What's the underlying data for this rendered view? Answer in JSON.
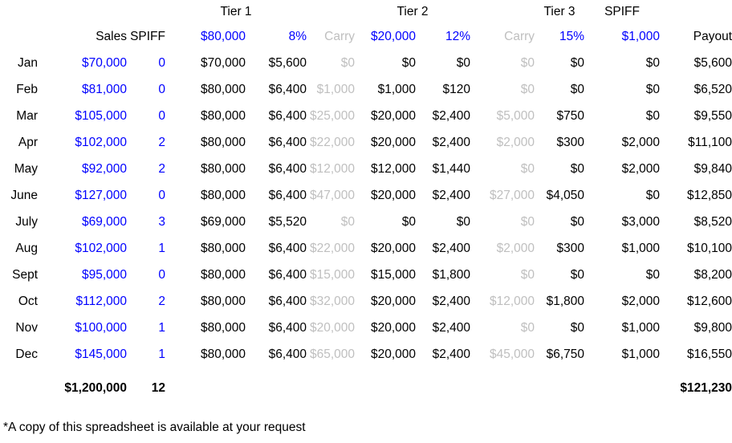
{
  "document": {
    "clipped_caption": "",
    "footnote": "*A copy of this spreadsheet is available at your request"
  },
  "group_headers": {
    "tier1": "Tier 1",
    "tier2": "Tier 2",
    "tier3": "Tier 3",
    "spiff": "SPIFF"
  },
  "columns": {
    "month": "",
    "sales": "Sales",
    "spiff_count": "SPIFF",
    "tier1_threshold": "$80,000",
    "tier1_rate": "8%",
    "carry1": "Carry",
    "tier2_threshold": "$20,000",
    "tier2_rate": "12%",
    "carry2": "Carry",
    "tier3_rate": "15%",
    "spiff_value": "$1,000",
    "payout": "Payout"
  },
  "colors": {
    "parameter_blue": "#0000FF",
    "carry_gray": "#BFBFBF",
    "text_black": "#000000",
    "background": "#FFFFFF"
  },
  "rows": [
    {
      "month": "Jan",
      "sales": "$70,000",
      "spiff_count": "0",
      "tier1_amount": "$70,000",
      "tier1_payout": "$5,600",
      "carry1": "$0",
      "tier2_amount": "$0",
      "tier2_payout": "$0",
      "carry2": "$0",
      "tier3_payout": "$0",
      "spiff_payout": "$0",
      "payout": "$5,600"
    },
    {
      "month": "Feb",
      "sales": "$81,000",
      "spiff_count": "0",
      "tier1_amount": "$80,000",
      "tier1_payout": "$6,400",
      "carry1": "$1,000",
      "tier2_amount": "$1,000",
      "tier2_payout": "$120",
      "carry2": "$0",
      "tier3_payout": "$0",
      "spiff_payout": "$0",
      "payout": "$6,520"
    },
    {
      "month": "Mar",
      "sales": "$105,000",
      "spiff_count": "0",
      "tier1_amount": "$80,000",
      "tier1_payout": "$6,400",
      "carry1": "$25,000",
      "tier2_amount": "$20,000",
      "tier2_payout": "$2,400",
      "carry2": "$5,000",
      "tier3_payout": "$750",
      "spiff_payout": "$0",
      "payout": "$9,550"
    },
    {
      "month": "Apr",
      "sales": "$102,000",
      "spiff_count": "2",
      "tier1_amount": "$80,000",
      "tier1_payout": "$6,400",
      "carry1": "$22,000",
      "tier2_amount": "$20,000",
      "tier2_payout": "$2,400",
      "carry2": "$2,000",
      "tier3_payout": "$300",
      "spiff_payout": "$2,000",
      "payout": "$11,100"
    },
    {
      "month": "May",
      "sales": "$92,000",
      "spiff_count": "2",
      "tier1_amount": "$80,000",
      "tier1_payout": "$6,400",
      "carry1": "$12,000",
      "tier2_amount": "$12,000",
      "tier2_payout": "$1,440",
      "carry2": "$0",
      "tier3_payout": "$0",
      "spiff_payout": "$2,000",
      "payout": "$9,840"
    },
    {
      "month": "June",
      "sales": "$127,000",
      "spiff_count": "0",
      "tier1_amount": "$80,000",
      "tier1_payout": "$6,400",
      "carry1": "$47,000",
      "tier2_amount": "$20,000",
      "tier2_payout": "$2,400",
      "carry2": "$27,000",
      "tier3_payout": "$4,050",
      "spiff_payout": "$0",
      "payout": "$12,850"
    },
    {
      "month": "July",
      "sales": "$69,000",
      "spiff_count": "3",
      "tier1_amount": "$69,000",
      "tier1_payout": "$5,520",
      "carry1": "$0",
      "tier2_amount": "$0",
      "tier2_payout": "$0",
      "carry2": "$0",
      "tier3_payout": "$0",
      "spiff_payout": "$3,000",
      "payout": "$8,520"
    },
    {
      "month": "Aug",
      "sales": "$102,000",
      "spiff_count": "1",
      "tier1_amount": "$80,000",
      "tier1_payout": "$6,400",
      "carry1": "$22,000",
      "tier2_amount": "$20,000",
      "tier2_payout": "$2,400",
      "carry2": "$2,000",
      "tier3_payout": "$300",
      "spiff_payout": "$1,000",
      "payout": "$10,100"
    },
    {
      "month": "Sept",
      "sales": "$95,000",
      "spiff_count": "0",
      "tier1_amount": "$80,000",
      "tier1_payout": "$6,400",
      "carry1": "$15,000",
      "tier2_amount": "$15,000",
      "tier2_payout": "$1,800",
      "carry2": "$0",
      "tier3_payout": "$0",
      "spiff_payout": "$0",
      "payout": "$8,200"
    },
    {
      "month": "Oct",
      "sales": "$112,000",
      "spiff_count": "2",
      "tier1_amount": "$80,000",
      "tier1_payout": "$6,400",
      "carry1": "$32,000",
      "tier2_amount": "$20,000",
      "tier2_payout": "$2,400",
      "carry2": "$12,000",
      "tier3_payout": "$1,800",
      "spiff_payout": "$2,000",
      "payout": "$12,600"
    },
    {
      "month": "Nov",
      "sales": "$100,000",
      "spiff_count": "1",
      "tier1_amount": "$80,000",
      "tier1_payout": "$6,400",
      "carry1": "$20,000",
      "tier2_amount": "$20,000",
      "tier2_payout": "$2,400",
      "carry2": "$0",
      "tier3_payout": "$0",
      "spiff_payout": "$1,000",
      "payout": "$9,800"
    },
    {
      "month": "Dec",
      "sales": "$145,000",
      "spiff_count": "1",
      "tier1_amount": "$80,000",
      "tier1_payout": "$6,400",
      "carry1": "$65,000",
      "tier2_amount": "$20,000",
      "tier2_payout": "$2,400",
      "carry2": "$45,000",
      "tier3_payout": "$6,750",
      "spiff_payout": "$1,000",
      "payout": "$16,550"
    }
  ],
  "totals": {
    "month": "",
    "sales": "$1,200,000",
    "spiff_count": "12",
    "tier1_amount": "",
    "tier1_payout": "",
    "carry1": "",
    "tier2_amount": "",
    "tier2_payout": "",
    "carry2": "",
    "tier3_payout": "",
    "spiff_payout": "",
    "payout": "$121,230"
  }
}
